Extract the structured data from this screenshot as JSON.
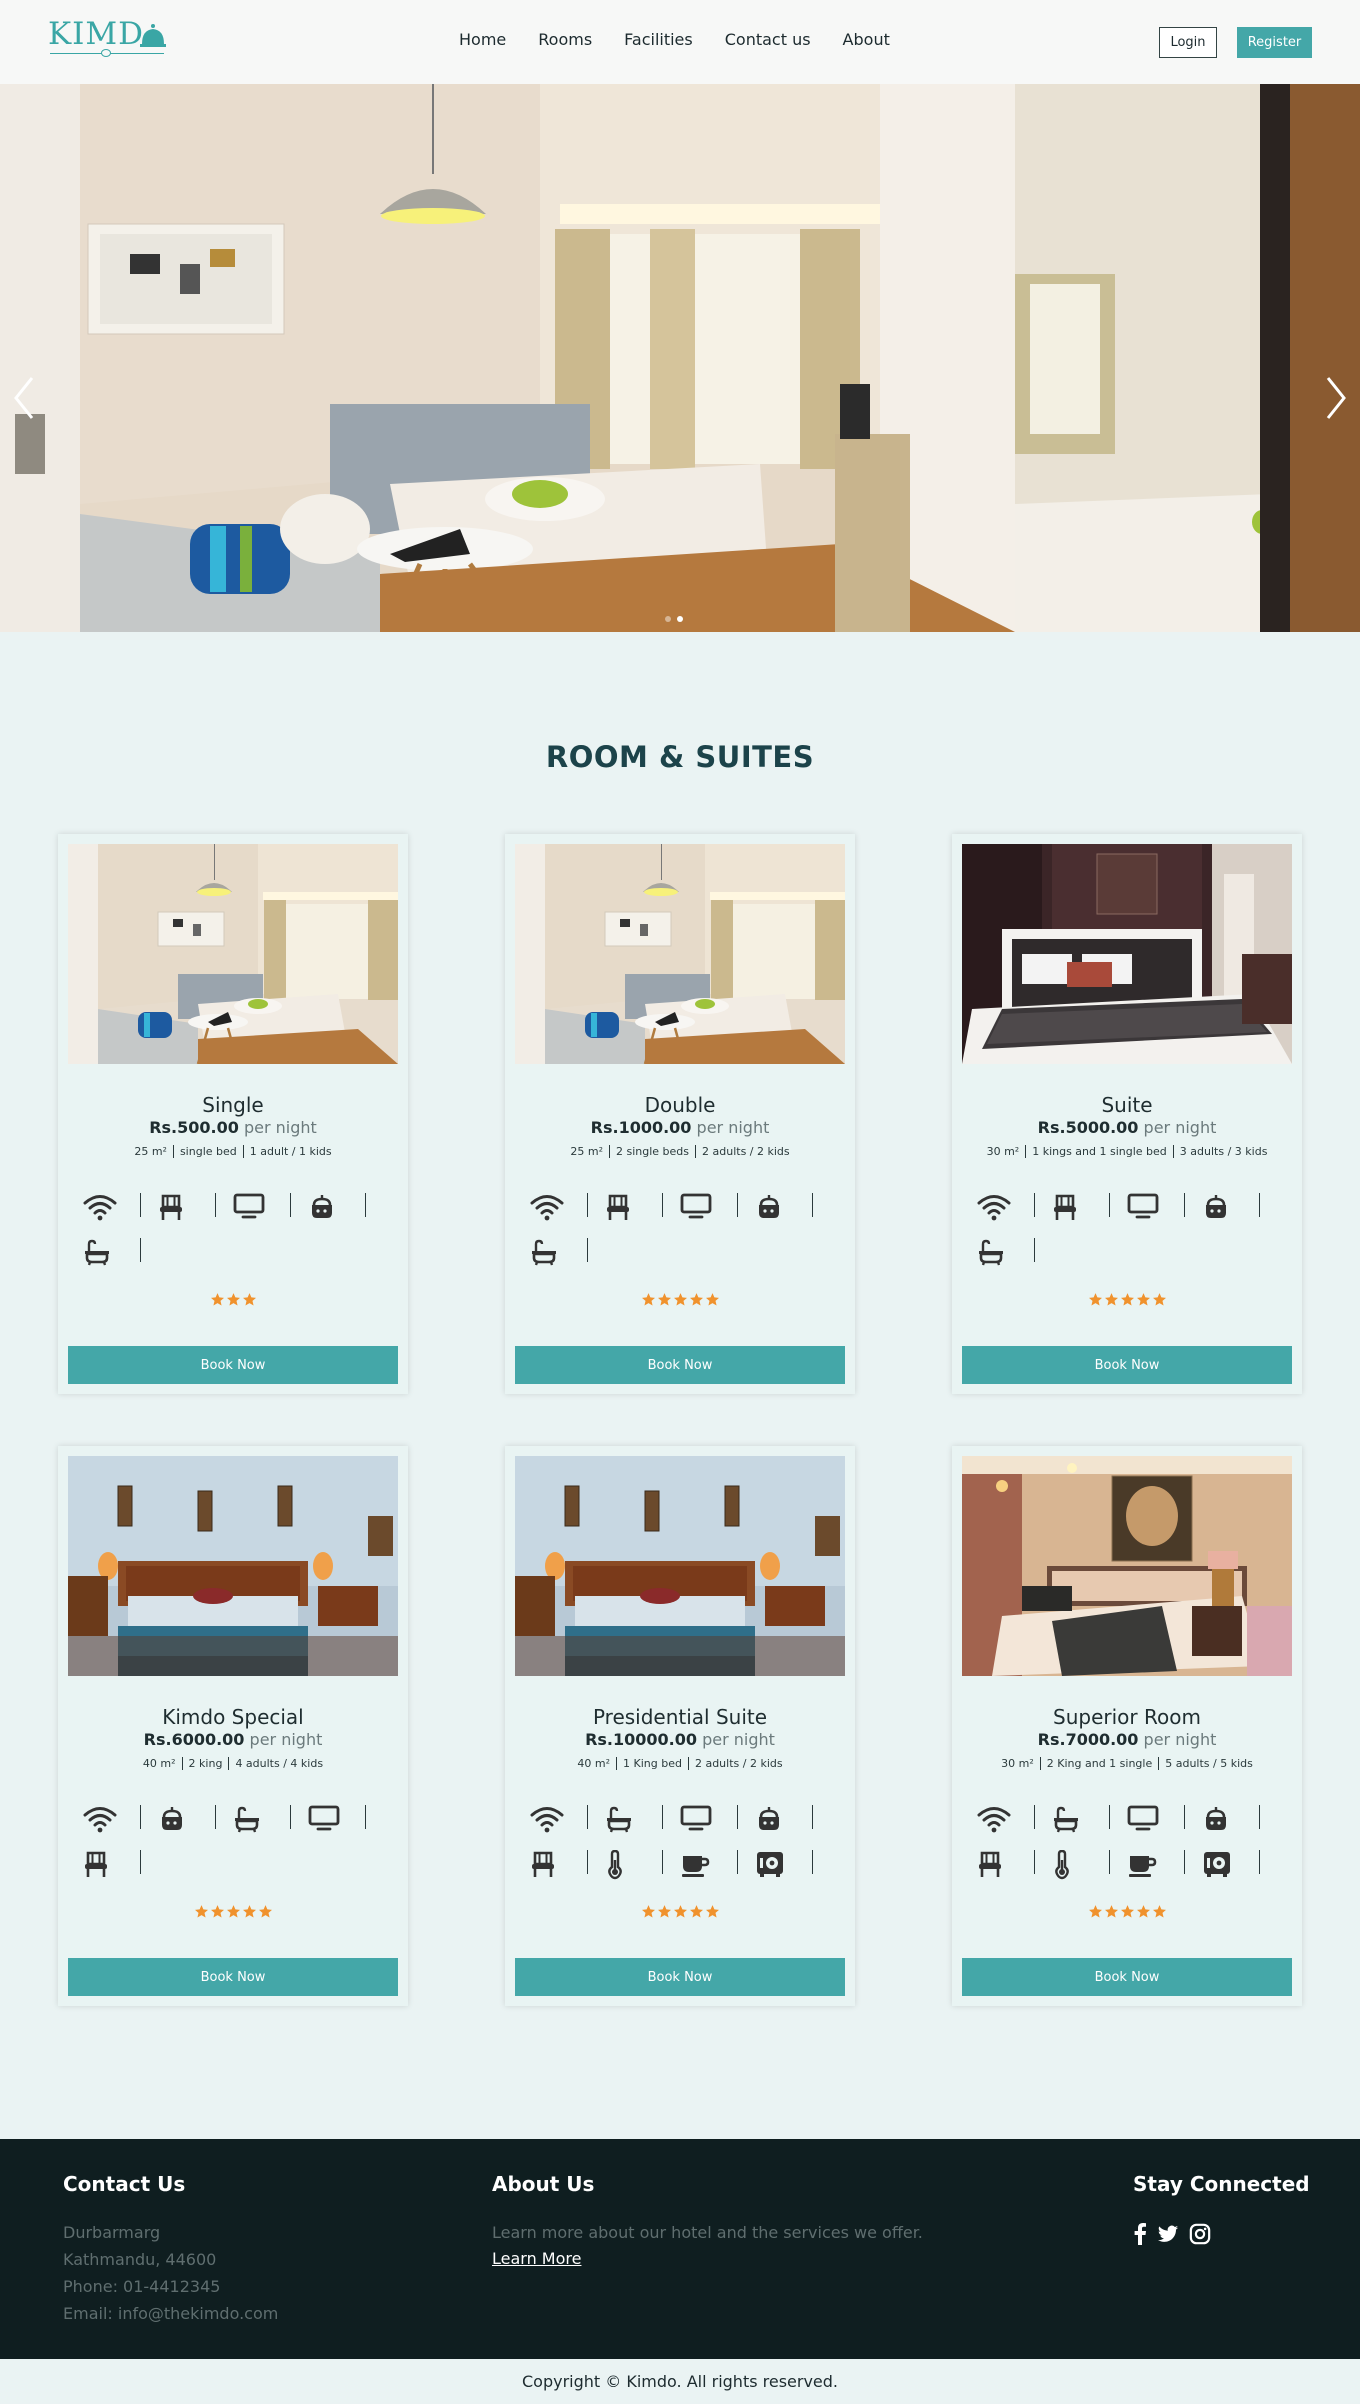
{
  "brand": {
    "logo_text": "KIMD",
    "accent": "#44a7a8"
  },
  "nav": {
    "links": [
      "Home",
      "Rooms",
      "Facilities",
      "Contact us",
      "About"
    ],
    "login": "Login",
    "register": "Register"
  },
  "hero": {
    "slides": 2,
    "active_slide": 1
  },
  "rooms": {
    "title": "ROOM & SUITES",
    "price_unit": "per night",
    "book_label": "Book Now",
    "items": [
      {
        "name": "Single",
        "price": "Rs.500.00",
        "meta": [
          "25 m²",
          "single bed",
          "1 adult / 1 kids"
        ],
        "amenities": [
          "wifi-icon",
          "chair-icon",
          "tv-icon",
          "kettle-icon",
          "bathtub-icon"
        ],
        "stars": 3,
        "image": "room-bright"
      },
      {
        "name": "Double",
        "price": "Rs.1000.00",
        "meta": [
          "25 m²",
          "2 single beds",
          "2 adults / 2 kids"
        ],
        "amenities": [
          "wifi-icon",
          "chair-icon",
          "tv-icon",
          "kettle-icon",
          "bathtub-icon"
        ],
        "stars": 5,
        "image": "room-bright"
      },
      {
        "name": "Suite",
        "price": "Rs.5000.00",
        "meta": [
          "30 m²",
          "1 kings and 1 single bed",
          "3 adults / 3 kids"
        ],
        "amenities": [
          "wifi-icon",
          "chair-icon",
          "tv-icon",
          "kettle-icon",
          "bathtub-icon"
        ],
        "stars": 5,
        "image": "room-dark"
      },
      {
        "name": "Kimdo Special",
        "price": "Rs.6000.00",
        "meta": [
          "40 m²",
          "2 king",
          "4 adults / 4 kids"
        ],
        "amenities": [
          "wifi-icon",
          "kettle-icon",
          "bathtub-icon",
          "tv-icon",
          "chair-icon"
        ],
        "stars": 5,
        "image": "room-blue"
      },
      {
        "name": "Presidential Suite",
        "price": "Rs.10000.00",
        "meta": [
          "40 m²",
          "1 King bed",
          "2 adults / 2 kids"
        ],
        "amenities": [
          "wifi-icon",
          "bathtub-icon",
          "tv-icon",
          "kettle-icon",
          "chair-icon",
          "thermometer-icon",
          "coffee-cup-icon",
          "safe-icon"
        ],
        "stars": 5,
        "image": "room-blue"
      },
      {
        "name": "Superior Room",
        "price": "Rs.7000.00",
        "meta": [
          "30 m²",
          "2 King and 1 single",
          "5 adults / 5 kids"
        ],
        "amenities": [
          "wifi-icon",
          "bathtub-icon",
          "tv-icon",
          "kettle-icon",
          "chair-icon",
          "thermometer-icon",
          "coffee-cup-icon",
          "safe-icon"
        ],
        "stars": 5,
        "image": "room-warm"
      }
    ]
  },
  "footer": {
    "contact_title": "Contact Us",
    "contact_lines": [
      "Durbarmarg",
      "Kathmandu, 44600",
      "Phone: 01-4412345",
      "Email: info@thekimdo.com"
    ],
    "about_title": "About Us",
    "about_text": "Learn more about our hotel and the services we offer.",
    "about_link": "Learn More",
    "social_title": "Stay Connected",
    "social_icons": [
      "facebook-icon",
      "twitter-icon",
      "instagram-icon"
    ]
  },
  "copyright": "Copyright © Kimdo. All rights reserved."
}
